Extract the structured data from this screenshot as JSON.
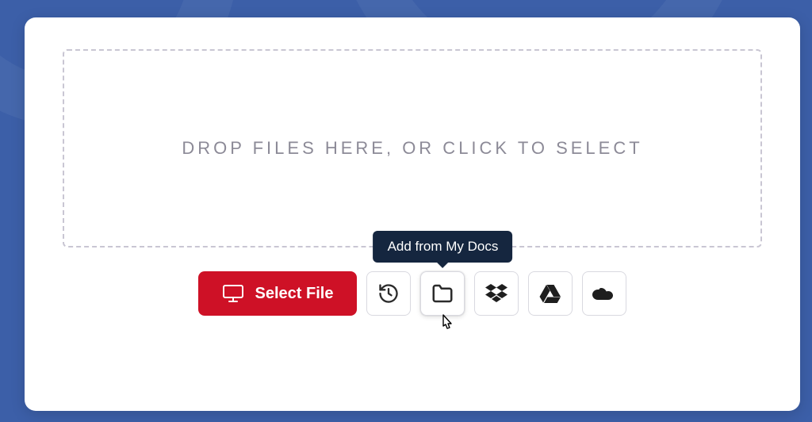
{
  "dropzone": {
    "text": "DROP FILES HERE, OR CLICK TO SELECT"
  },
  "toolbar": {
    "select_file_label": "Select File",
    "tooltip_my_docs": "Add from My Docs"
  }
}
